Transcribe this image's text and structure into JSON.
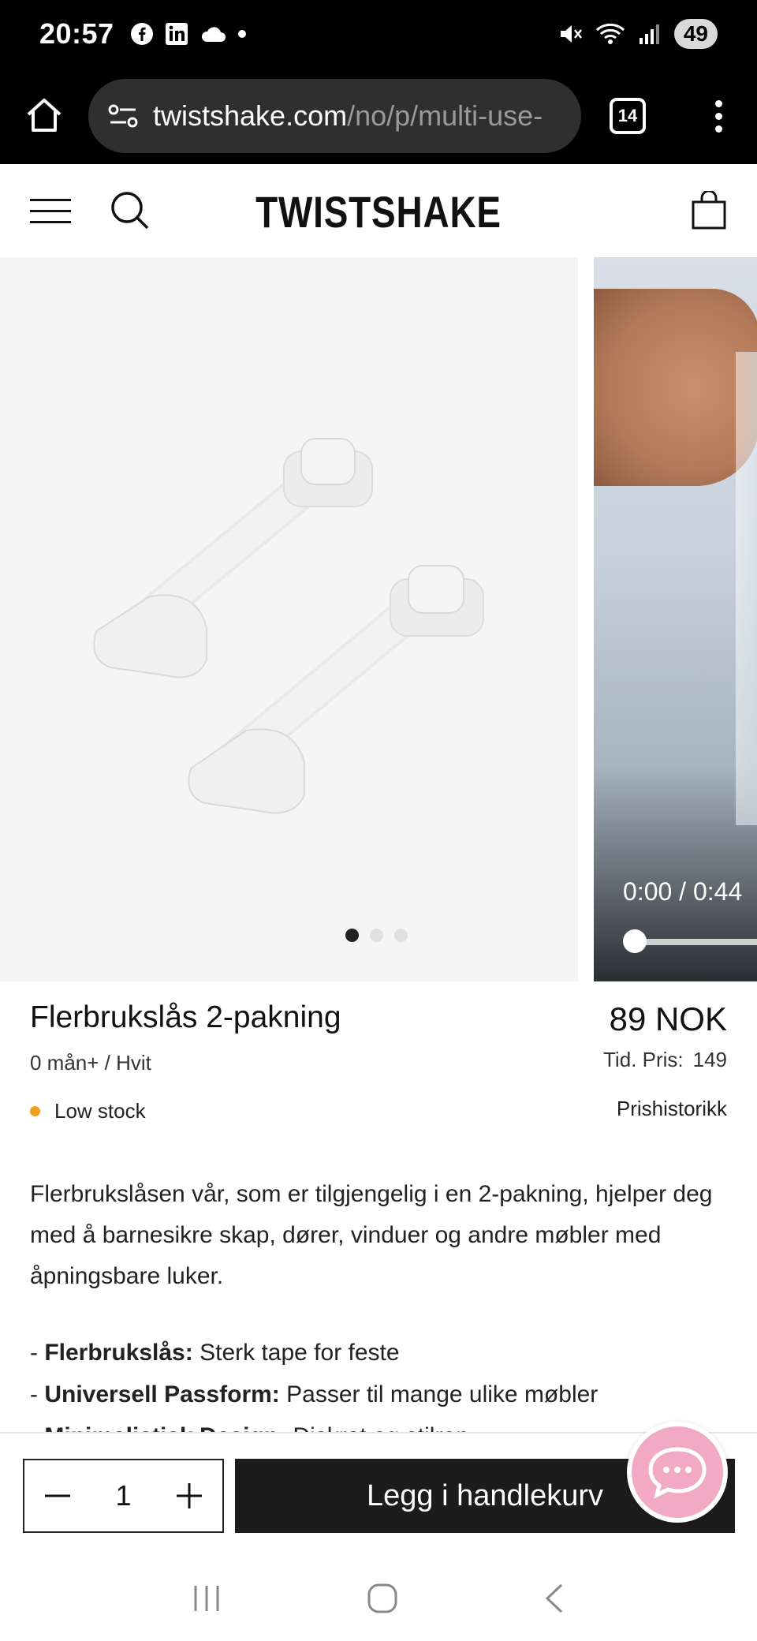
{
  "status_bar": {
    "time": "20:57",
    "battery": "49",
    "left_icons": [
      "facebook-icon",
      "linkedin-icon",
      "cloud-icon",
      "dot-icon"
    ],
    "right_icons": [
      "mute-icon",
      "wifi-icon",
      "signal-icon"
    ]
  },
  "browser": {
    "url_host": "twistshake.com",
    "url_path": "/no/p/multi-use-",
    "tab_count": "14"
  },
  "header": {
    "brand": "TWISTSHAKE"
  },
  "gallery": {
    "video_time": "0:00 / 0:44",
    "slides": 3,
    "active_slide": 0
  },
  "product": {
    "title": "Flerbrukslås 2-pakning",
    "variant": "0 mån+ / Hvit",
    "stock": "Low stock",
    "price": "89 NOK",
    "previous_price_label": "Tid. Pris:",
    "previous_price_value": "149",
    "price_history": "Prishistorikk",
    "description": "Flerbrukslåsen vår, som er tilgjengelig i en 2-pakning, hjelper deg med å barnesikre skap, dører, vinduer og andre møbler med åpningsbare luker.",
    "features": [
      {
        "label": "Flerbrukslås:",
        "text": "Sterk tape for feste"
      },
      {
        "label": "Universell Passform:",
        "text": "Passer til mange ulike møbler"
      },
      {
        "label": "Minimalistisk Design:",
        "text": "Diskret og stilren"
      }
    ]
  },
  "cart_bar": {
    "quantity": "1",
    "add_label": "Legg i handlekurv"
  },
  "colors": {
    "stock_dot": "#f0a020",
    "chat_fab": "#f2a9c4",
    "add_button": "#1c1c1c"
  }
}
